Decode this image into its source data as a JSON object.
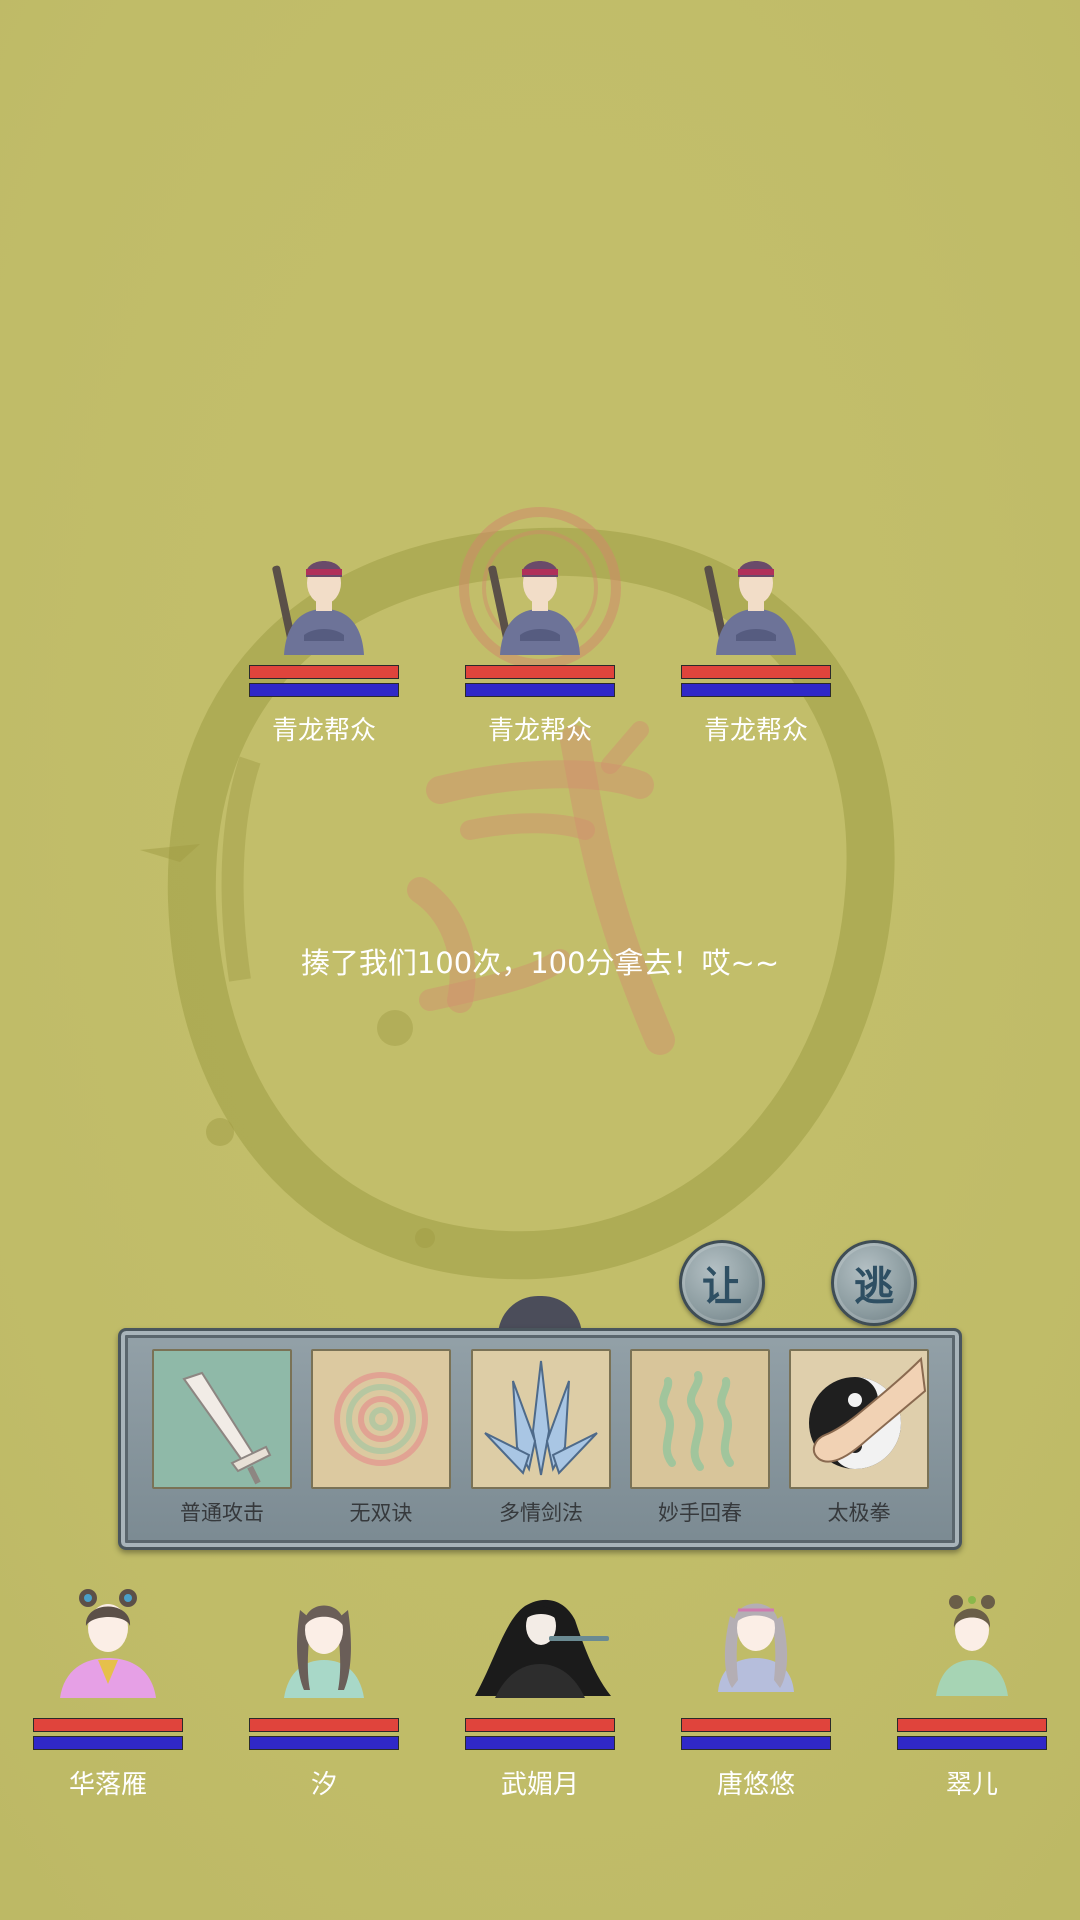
{
  "colors": {
    "background": "#c2be6a",
    "hp_bar": "#e0443c",
    "mp_bar": "#3028c8",
    "name_text": "#ffffff",
    "panel": "#8695a0",
    "skill_label": "#36393c"
  },
  "background": {
    "emblem_icon": "ink-circle-wu-seal-icon"
  },
  "enemies": [
    {
      "name": "青龙帮众",
      "hp": 1.0,
      "mp": 1.0,
      "icon": "bandit-with-staff-icon"
    },
    {
      "name": "青龙帮众",
      "hp": 1.0,
      "mp": 1.0,
      "icon": "bandit-with-staff-icon"
    },
    {
      "name": "青龙帮众",
      "hp": 1.0,
      "mp": 1.0,
      "icon": "bandit-with-staff-icon"
    }
  ],
  "battle_message": "揍了我们100次，100分拿去！哎~~",
  "actions": {
    "yield": "让",
    "flee": "逃"
  },
  "skills": [
    {
      "label": "普通攻击",
      "icon": "sword-icon"
    },
    {
      "label": "无双诀",
      "icon": "spiral-icon"
    },
    {
      "label": "多情剑法",
      "icon": "multi-blade-icon"
    },
    {
      "label": "妙手回春",
      "icon": "healing-wave-icon"
    },
    {
      "label": "太极拳",
      "icon": "yin-yang-fist-icon"
    }
  ],
  "party": [
    {
      "name": "华落雁",
      "hp": 1.0,
      "mp": 1.0,
      "icon": "heroine-pink-robe-icon"
    },
    {
      "name": "汐",
      "hp": 1.0,
      "mp": 1.0,
      "icon": "heroine-braids-icon"
    },
    {
      "name": "武媚月",
      "hp": 1.0,
      "mp": 1.0,
      "icon": "heroine-flute-icon"
    },
    {
      "name": "唐悠悠",
      "hp": 1.0,
      "mp": 1.0,
      "icon": "heroine-silver-hair-icon"
    },
    {
      "name": "翠儿",
      "hp": 1.0,
      "mp": 1.0,
      "icon": "heroine-green-robe-icon"
    }
  ]
}
